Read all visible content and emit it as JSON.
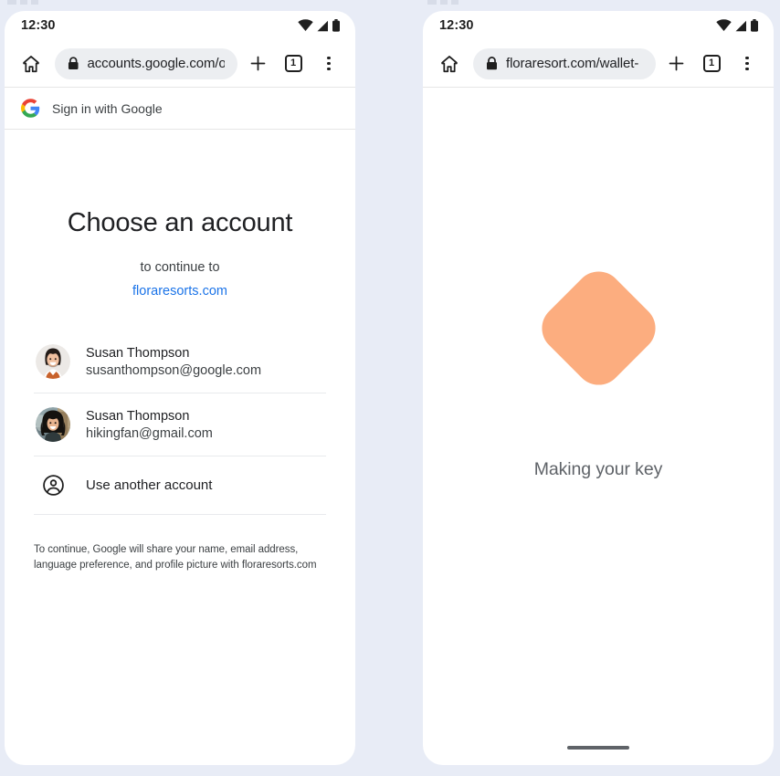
{
  "background_color": "#e8ecf6",
  "left_phone": {
    "status_bar": {
      "time": "12:30",
      "icons": [
        "wifi-icon",
        "signal-icon",
        "battery-icon"
      ]
    },
    "browser": {
      "home_icon": "home-icon",
      "lock_icon": "lock-icon",
      "url": "accounts.google.com/o/",
      "new_tab_icon": "plus-icon",
      "tab_count": "1",
      "menu_icon": "more-vertical-icon"
    },
    "google_header": {
      "logo": "google-g-icon",
      "label": "Sign in with Google"
    },
    "content": {
      "title": "Choose an account",
      "subtitle": "to continue to",
      "domain": "floraresorts.com",
      "accounts": [
        {
          "name": "Susan Thompson",
          "email": "susanthompson@google.com",
          "avatar": "avatar-susan-work"
        },
        {
          "name": "Susan Thompson",
          "email": "hikingfan@gmail.com",
          "avatar": "avatar-susan-personal"
        }
      ],
      "another_account": {
        "icon": "account-circle-icon",
        "label": "Use another account"
      },
      "legal_text": "To continue, Google will share your name, email address, language preference, and profile picture with floraresorts.com"
    }
  },
  "right_phone": {
    "status_bar": {
      "time": "12:30",
      "icons": [
        "wifi-icon",
        "signal-icon",
        "battery-icon"
      ]
    },
    "browser": {
      "home_icon": "home-icon",
      "lock_icon": "lock-icon",
      "url": "floraresort.com/wallet-",
      "new_tab_icon": "plus-icon",
      "tab_count": "1",
      "menu_icon": "more-vertical-icon"
    },
    "content": {
      "shape": "rotated-rounded-square",
      "shape_color": "#fcad7f",
      "label": "Making your key"
    }
  },
  "colors": {
    "link_blue": "#1a73e8",
    "text_primary": "#202124",
    "text_secondary": "#3c4043",
    "text_muted": "#5f6368",
    "url_pill_bg": "#eceef1",
    "peach": "#fcad7f"
  }
}
